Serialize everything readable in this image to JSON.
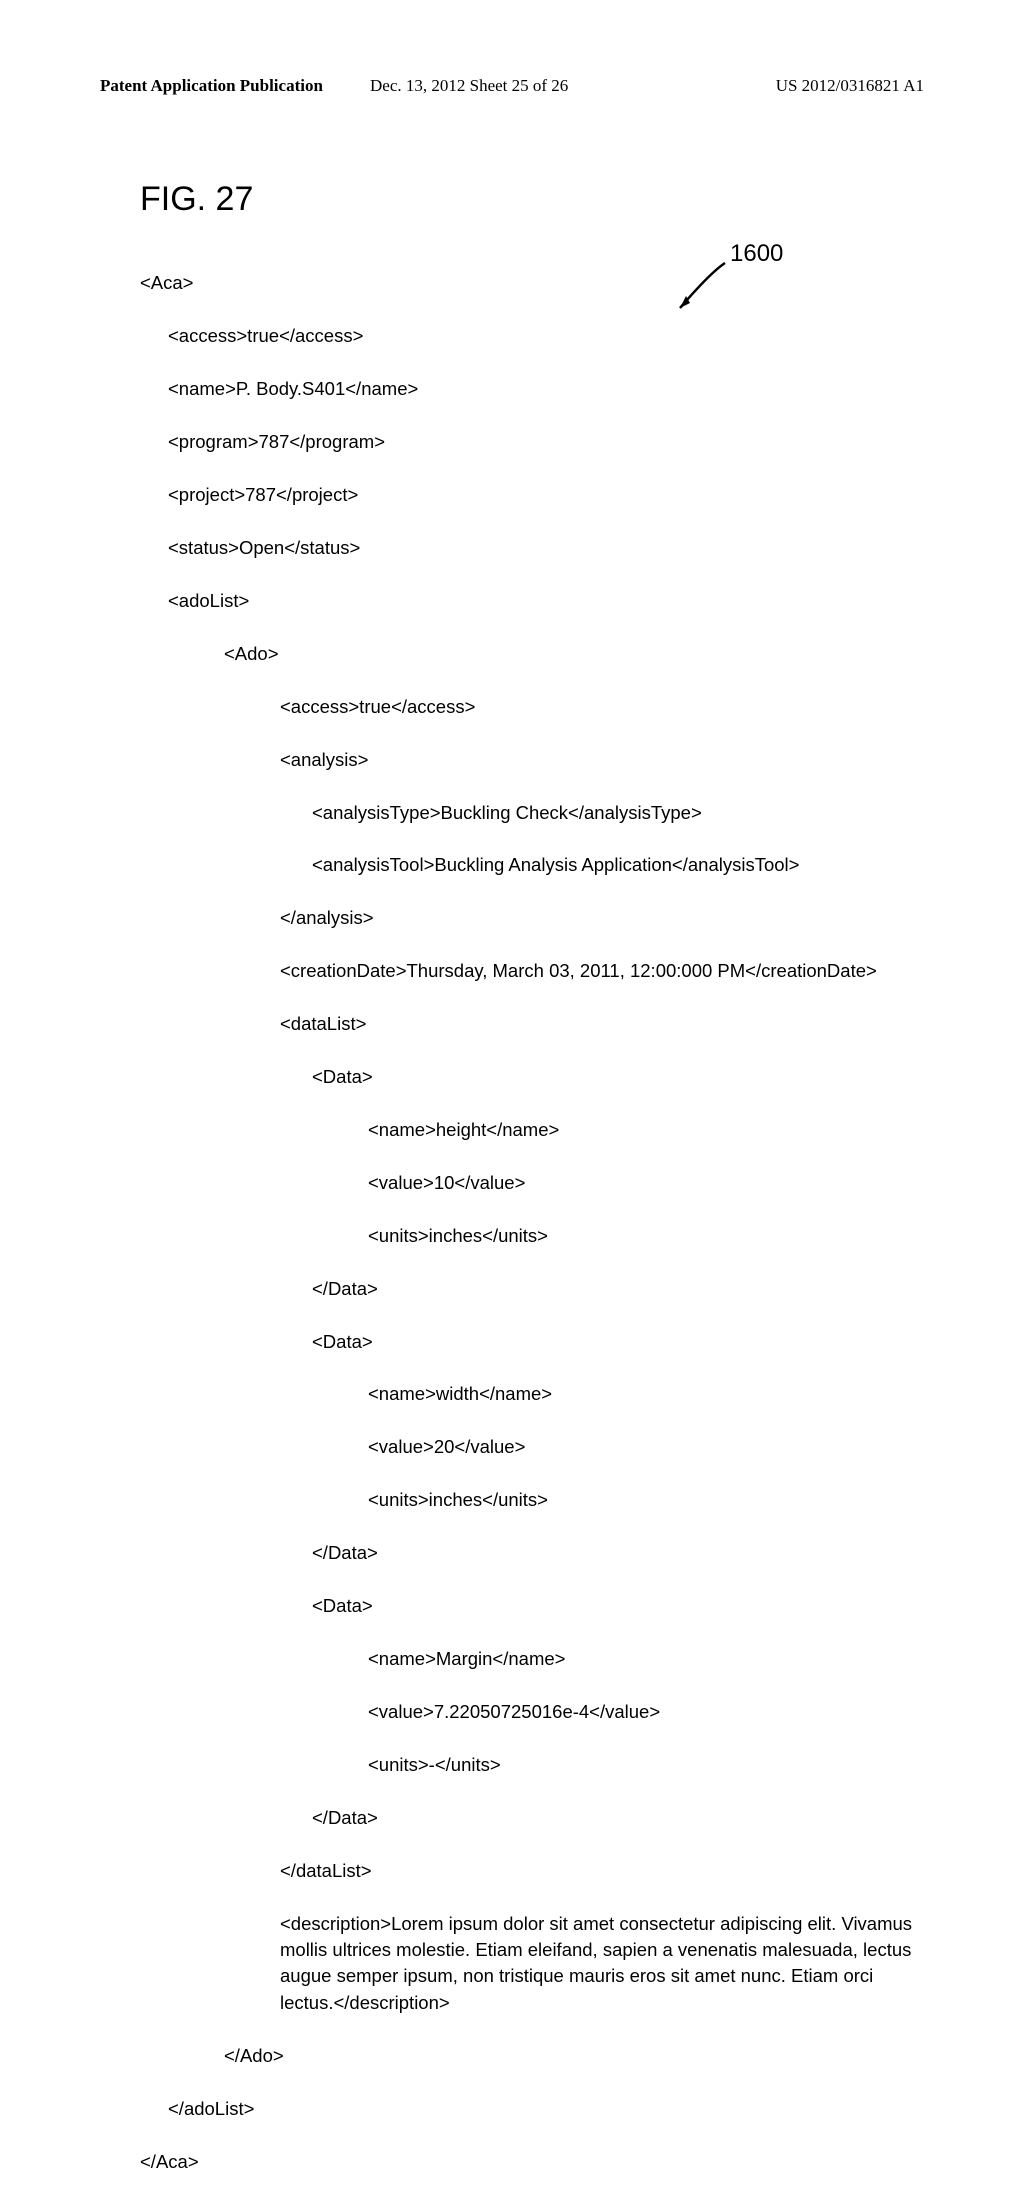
{
  "header": {
    "left": "Patent Application Publication",
    "center": "Dec. 13, 2012  Sheet 25 of 26",
    "right": "US 2012/0316821 A1"
  },
  "figure_label": "FIG. 27",
  "callout": "1600",
  "xml": {
    "root_open": "<Aca>",
    "access": "<access>true</access>",
    "name": "<name>P. Body.S401</name>",
    "program": "<program>787</program>",
    "project": "<project>787</project>",
    "status": "<status>Open</status>",
    "adolist_open": "<adoList>",
    "ado_open": "<Ado>",
    "ado_access": "<access>true</access>",
    "analysis_open": "<analysis>",
    "analysis_type": "<analysisType>Buckling Check</analysisType>",
    "analysis_tool": "<analysisTool>Buckling Analysis Application</analysisTool>",
    "analysis_close": "</analysis>",
    "creation_date": "<creationDate>Thursday, March 03, 2011, 12:00:000 PM</creationDate>",
    "datalist_open": "<dataList>",
    "d1_open": "<Data>",
    "d1_name": "<name>height</name>",
    "d1_value": "<value>10</value>",
    "d1_units": "<units>inches</units>",
    "d1_close": "</Data>",
    "d2_open": "<Data>",
    "d2_name": "<name>width</name>",
    "d2_value": "<value>20</value>",
    "d2_units": "<units>inches</units>",
    "d2_close": "</Data>",
    "d3_open": "<Data>",
    "d3_name": "<name>Margin</name>",
    "d3_value": "<value>7.22050725016e-4</value>",
    "d3_units": "<units>-</units>",
    "d3_close": "</Data>",
    "datalist_close": "</dataList>",
    "description": "<description>Lorem ipsum dolor sit amet consectetur adipiscing elit. Vivamus mollis ultrices molestie. Etiam eleifand, sapien a venenatis malesuada, lectus augue semper ipsum, non tristique mauris eros sit amet nunc. Etiam orci lectus.</description>",
    "ado_close": "</Ado>",
    "adolist_close": "</adoList>",
    "root_close": "</Aca>"
  }
}
